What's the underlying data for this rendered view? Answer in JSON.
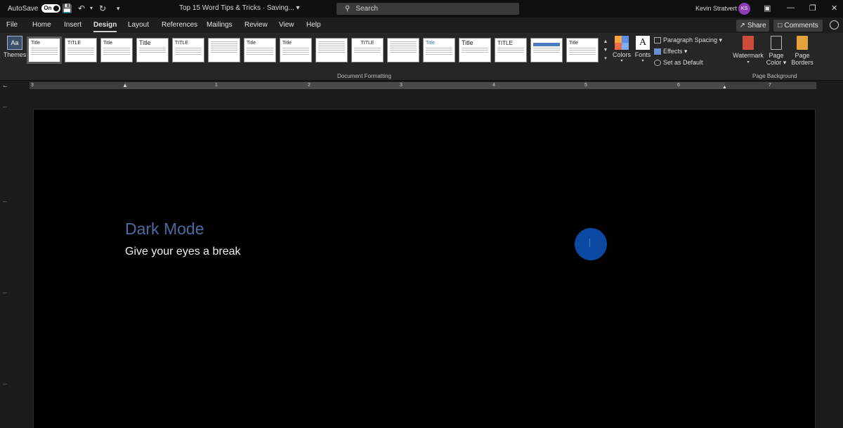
{
  "titlebar": {
    "autosave_label": "AutoSave",
    "autosave_state": "On",
    "doc_title": "Top 15 Word Tips & Tricks · Saving... ▾",
    "search_placeholder": "Search",
    "user_name": "Kevin Stratvert",
    "user_initials": "KS"
  },
  "menu": {
    "tabs": [
      "File",
      "Home",
      "Insert",
      "Design",
      "Layout",
      "References",
      "Mailings",
      "Review",
      "View",
      "Help"
    ],
    "active_tab": "Design",
    "share_label": "Share",
    "comments_label": "Comments"
  },
  "ribbon": {
    "themes_label": "Themes",
    "style_set_titles": [
      "Title",
      "TITLE",
      "Title",
      "Title",
      "TITLE",
      "",
      "Title",
      "Title",
      "TITLE",
      "",
      "Title",
      "Title",
      "TITLE",
      "",
      "",
      "Title"
    ],
    "colors_label": "Colors",
    "fonts_label": "Fonts",
    "paragraph_spacing_label": "Paragraph Spacing ▾",
    "effects_label": "Effects ▾",
    "set_default_label": "Set as Default",
    "document_formatting_label": "Document Formatting",
    "watermark_label": "Watermark",
    "page_color_label_1": "Page",
    "page_color_label_2": "Color ▾",
    "page_borders_label_1": "Page",
    "page_borders_label_2": "Borders",
    "page_background_label": "Page Background",
    "colors_swatch": [
      "#f5a53a",
      "#5a8ee6",
      "#ed6b4a",
      "#7db0f0"
    ]
  },
  "ruler": {
    "numbers": [
      "3",
      "1",
      "2",
      "3",
      "4",
      "5",
      "6",
      "7"
    ]
  },
  "document": {
    "heading": "Dark Mode",
    "body": "Give your eyes a break",
    "heading_color": "#4d6aa0",
    "page_background": "#000000"
  }
}
